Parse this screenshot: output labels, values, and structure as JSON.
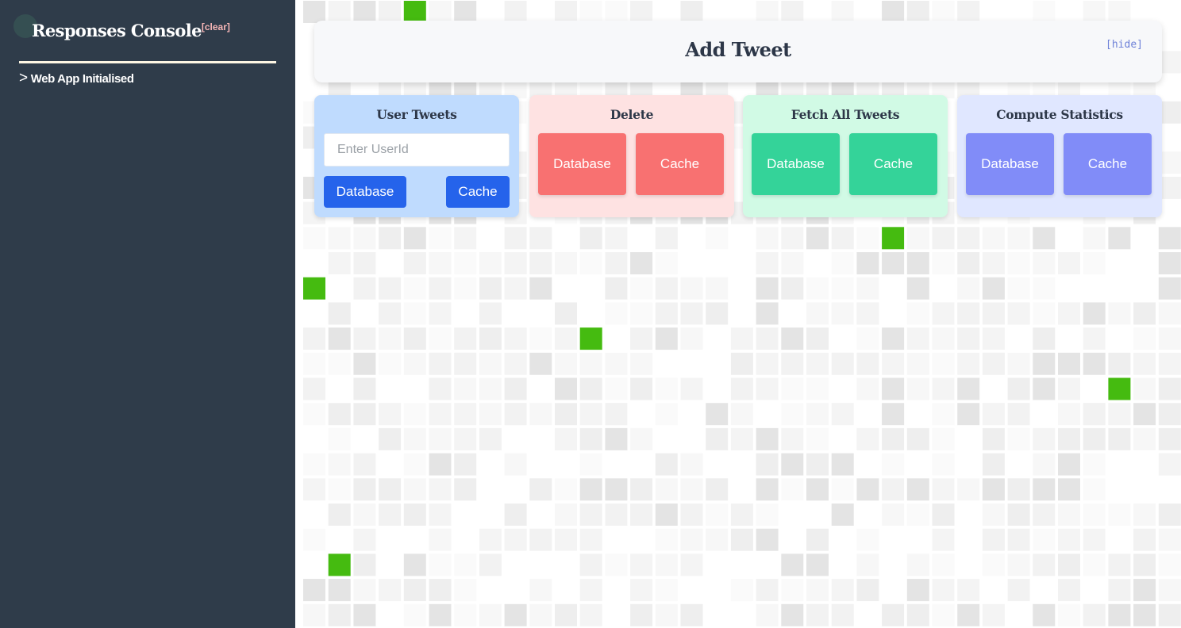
{
  "console": {
    "title": "Responses Console",
    "clear_label": "[clear]",
    "log_prompt": ">",
    "log_entries": [
      "Web App Initialised"
    ]
  },
  "header": {
    "title": "Add Tweet",
    "hide_label": "[hide]"
  },
  "cards": {
    "user_tweets": {
      "title": "User Tweets",
      "input_placeholder": "Enter UserId",
      "input_value": "",
      "database_label": "Database",
      "cache_label": "Cache"
    },
    "delete": {
      "title": "Delete",
      "database_label": "Database",
      "cache_label": "Cache"
    },
    "fetch_all": {
      "title": "Fetch All Tweets",
      "database_label": "Database",
      "cache_label": "Cache"
    },
    "compute_stats": {
      "title": "Compute Statistics",
      "database_label": "Database",
      "cache_label": "Cache"
    }
  },
  "colors": {
    "sidebar_bg": "#2f3c4a",
    "grid_highlight": "#45bb10",
    "user_card": "#bfdbfe",
    "user_button": "#2563eb",
    "delete_card": "#fee2e2",
    "delete_button": "#f87171",
    "fetch_card": "#d1fae5",
    "fetch_button": "#34d399",
    "stats_card": "#e0e7ff",
    "stats_button": "#818cf8"
  }
}
